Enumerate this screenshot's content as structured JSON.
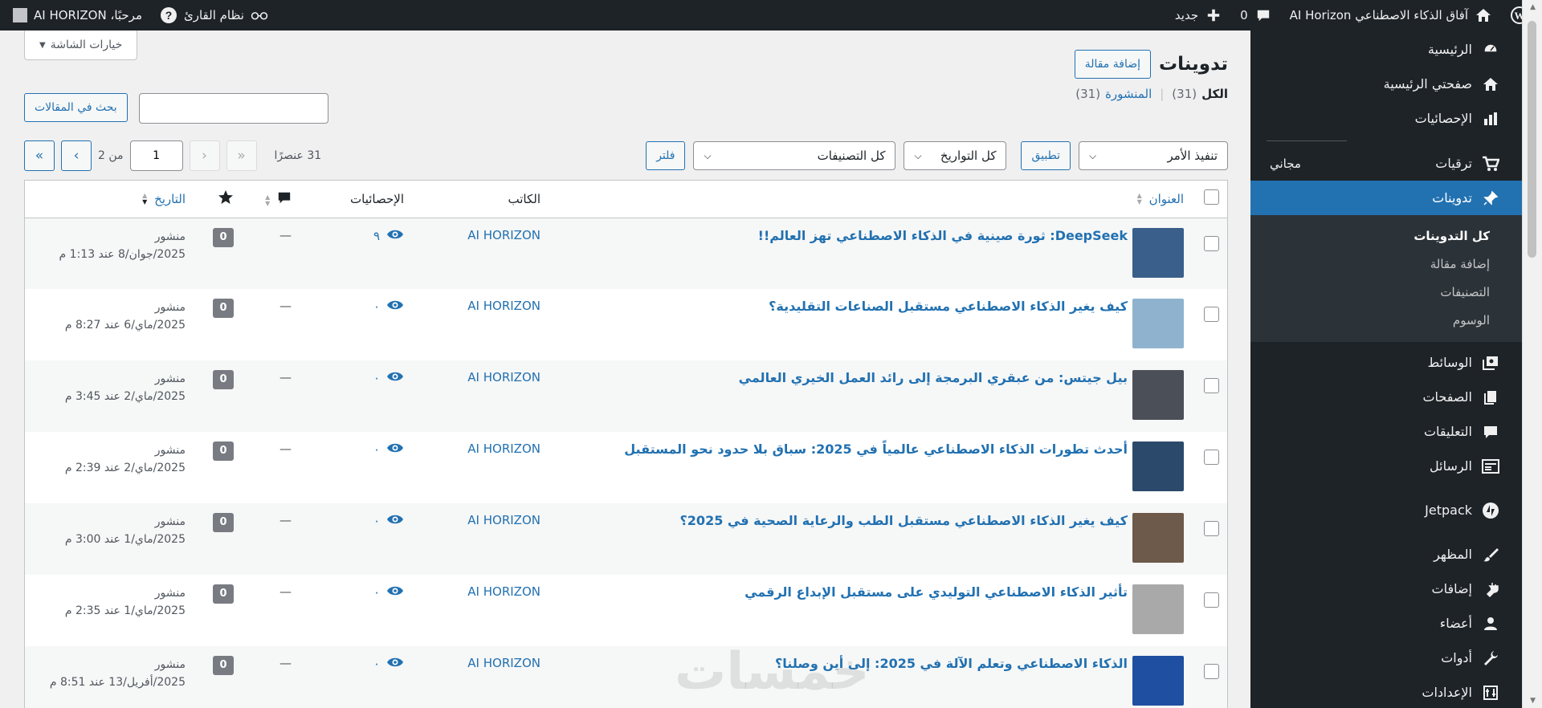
{
  "adminbar": {
    "site_name": "آفاق الذكاء الاصطناعي AI Horizon",
    "comments_count": "0",
    "new_label": "جديد",
    "reader_label": "نظام القارئ",
    "greeting": "مرحبًا، AI HORIZON"
  },
  "sidebar": {
    "items": [
      {
        "label": "الرئيسية",
        "icon": "dashboard-icon"
      },
      {
        "label": "صفحتي الرئيسية",
        "icon": "home-icon"
      },
      {
        "label": "الإحصائيات",
        "icon": "stats-icon"
      },
      {
        "label": "ترقيات",
        "icon": "cart-icon",
        "badge": "مجاني"
      },
      {
        "label": "تدوينات",
        "icon": "pin-icon",
        "current": true
      },
      {
        "label": "الوسائط",
        "icon": "media-icon"
      },
      {
        "label": "الصفحات",
        "icon": "pages-icon"
      },
      {
        "label": "التعليقات",
        "icon": "comments-icon"
      },
      {
        "label": "الرسائل",
        "icon": "feedback-icon"
      },
      {
        "label": "Jetpack",
        "icon": "jetpack-icon"
      },
      {
        "label": "المظهر",
        "icon": "brush-icon"
      },
      {
        "label": "إضافات",
        "icon": "plugin-icon"
      },
      {
        "label": "أعضاء",
        "icon": "user-icon"
      },
      {
        "label": "أدوات",
        "icon": "wrench-icon"
      },
      {
        "label": "الإعدادات",
        "icon": "settings-icon"
      }
    ],
    "submenu": [
      "كل التدوينات",
      "إضافة مقالة",
      "التصنيفات",
      "الوسوم"
    ]
  },
  "screen_options": "خيارات الشاشة",
  "page": {
    "title": "تدوينات",
    "add_new": "إضافة مقالة",
    "views": {
      "all": "الكل",
      "all_count": "(31)",
      "published": "المنشورة",
      "published_count": "(31)",
      "sep": "|"
    }
  },
  "search": {
    "button": "بحث في المقالات",
    "value": ""
  },
  "tablenav": {
    "bulk_action": "تنفيذ الأمر",
    "apply": "تطبيق",
    "dates": "كل التواريخ",
    "categories": "كل التصنيفات",
    "filter": "فلتر",
    "items_count": "31 عنصرًا",
    "current_page": "1",
    "of_label": "من 2"
  },
  "columns": {
    "title": "العنوان",
    "author": "الكاتب",
    "stats": "الإحصائيات",
    "date": "التاريخ"
  },
  "posts": [
    {
      "title": "DeepSeek: ثورة صينية في الذكاء الاصطناعي تهز العالم!!",
      "author": "AI HORIZON",
      "views": "٩",
      "comments": "—",
      "likes": "0",
      "status": "منشور",
      "date": "2025/جوان/8 عند 1:13 م",
      "thumb": "#3a5f8a"
    },
    {
      "title": "كيف يغير الذكاء الاصطناعي مستقبل الصناعات التقليدية؟",
      "author": "AI HORIZON",
      "views": "٠",
      "comments": "—",
      "likes": "0",
      "status": "منشور",
      "date": "2025/ماي/6 عند 8:27 م",
      "thumb": "#8fb3cf"
    },
    {
      "title": "بيل جيتس: من عبقري البرمجة إلى رائد العمل الخيري العالمي",
      "author": "AI HORIZON",
      "views": "٠",
      "comments": "—",
      "likes": "0",
      "status": "منشور",
      "date": "2025/ماي/2 عند 3:45 م",
      "thumb": "#4b4f58"
    },
    {
      "title": "أحدث تطورات الذكاء الاصطناعي عالمياً في 2025: سباق بلا حدود نحو المستقبل",
      "author": "AI HORIZON",
      "views": "٠",
      "comments": "—",
      "likes": "0",
      "status": "منشور",
      "date": "2025/ماي/2 عند 2:39 م",
      "thumb": "#2b4a6b"
    },
    {
      "title": "كيف يغير الذكاء الاصطناعي مستقبل الطب والرعاية الصحية في 2025؟",
      "author": "AI HORIZON",
      "views": "٠",
      "comments": "—",
      "likes": "0",
      "status": "منشور",
      "date": "2025/ماي/1 عند 3:00 م",
      "thumb": "#6d5a4a"
    },
    {
      "title": "تأثير الذكاء الاصطناعي التوليدي على مستقبل الإبداع الرقمي",
      "author": "AI HORIZON",
      "views": "٠",
      "comments": "—",
      "likes": "0",
      "status": "منشور",
      "date": "2025/ماي/1 عند 2:35 م",
      "thumb": "#a9a9a9"
    },
    {
      "title": "الذكاء الاصطناعي وتعلم الآلة في 2025: إلى أين وصلنا؟",
      "author": "AI HORIZON",
      "views": "٠",
      "comments": "—",
      "likes": "0",
      "status": "منشور",
      "date": "2025/أفريل/13 عند 8:51 م",
      "thumb": "#1e4fa0"
    }
  ],
  "watermark": "خمسات"
}
